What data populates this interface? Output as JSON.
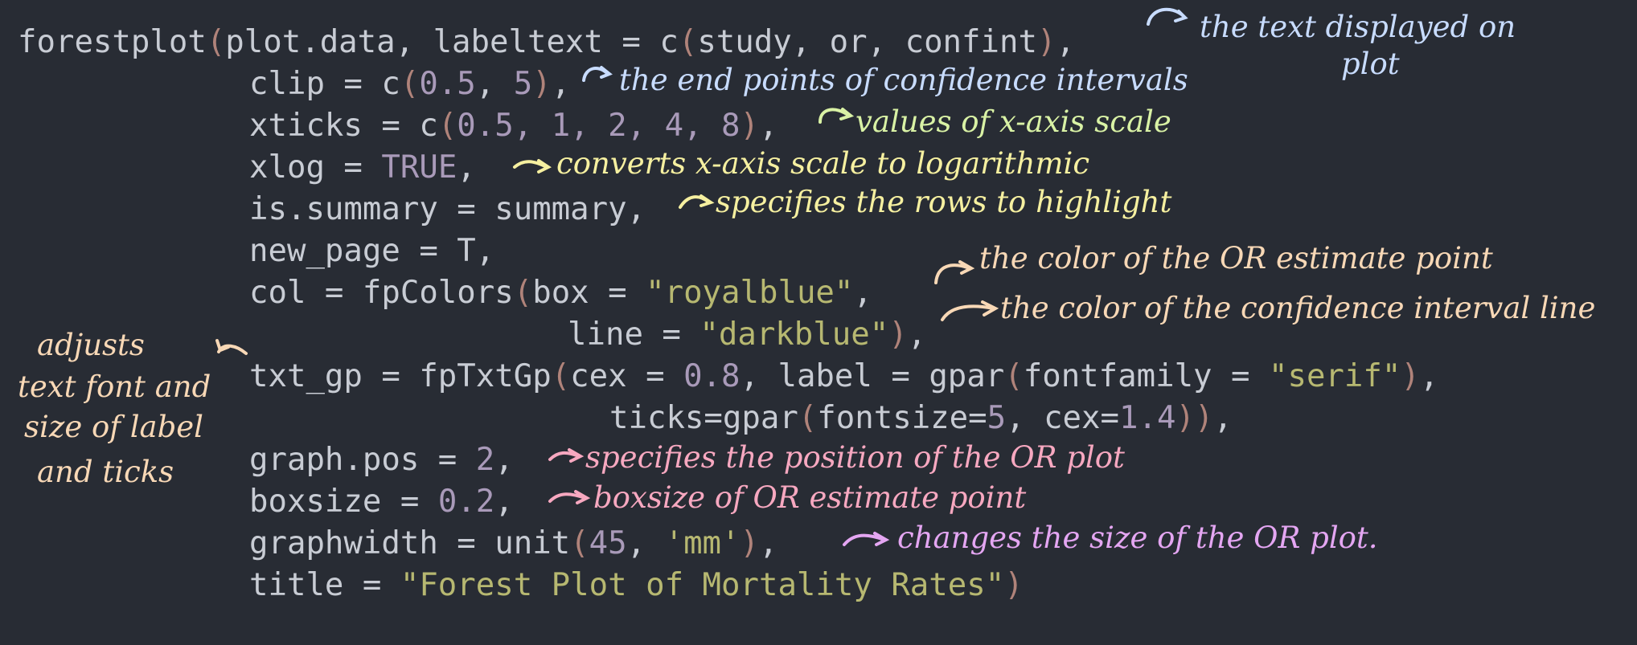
{
  "code": {
    "l1": {
      "fn": "forestplot",
      "p1": "(",
      "args": "plot.data, labeltext = c",
      "p2": "(",
      "inner": "study, or, confint",
      "p3": ")",
      "tail": ","
    },
    "l2": {
      "pre": "clip = c",
      "p1": "(",
      "n1": "0.5",
      "mid": ", ",
      "n2": "5",
      "p2": ")",
      "tail": ","
    },
    "l3": {
      "pre": "xticks = c",
      "p1": "(",
      "vals": "0.5, 1, 2, 4, 8",
      "p2": ")",
      "tail": ","
    },
    "l4": {
      "pre": "xlog = ",
      "kw": "TRUE",
      "tail": ","
    },
    "l5": {
      "text": "is.summary = summary,"
    },
    "l6": {
      "text": "new_page = T,"
    },
    "l7": {
      "pre": "col = fpColors",
      "p1": "(",
      "mid": "box = ",
      "str": "\"royalblue\"",
      "tail": ","
    },
    "l8": {
      "pre": "line = ",
      "str": "\"darkblue\"",
      "p1": ")",
      "tail": ","
    },
    "l9": {
      "pre": "txt_gp = fpTxtGp",
      "p1": "(",
      "a": "cex = ",
      "n1": "0.8",
      "b": ", label = gpar",
      "p2": "(",
      "c": "fontfamily = ",
      "str": "\"serif\"",
      "p3": ")",
      "tail": ","
    },
    "l10": {
      "pre": "ticks=gpar",
      "p1": "(",
      "a": "fontsize=",
      "n1": "5",
      "b": ", cex=",
      "n2": "1.4",
      "p2": "))",
      "tail": ","
    },
    "l11": {
      "pre": "graph.pos = ",
      "n1": "2",
      "tail": ","
    },
    "l12": {
      "pre": "boxsize = ",
      "n1": "0.2",
      "tail": ","
    },
    "l13": {
      "pre": "graphwidth = unit",
      "p1": "(",
      "n1": "45",
      "mid": ", ",
      "str": "'mm'",
      "p2": ")",
      "tail": ","
    },
    "l14": {
      "pre": "title = ",
      "str": "\"Forest Plot of Mortality Rates\"",
      "p1": ")"
    }
  },
  "annotations": {
    "labeltext_line1": "the text displayed on",
    "labeltext_line2": "plot",
    "clip": "the end points of confidence intervals",
    "xticks": "values of x-axis scale",
    "xlog": "converts x-axis scale to logarithmic",
    "summary": "specifies the rows to highlight",
    "box": "the color of the OR estimate point",
    "line": "the color of the confidence interval line",
    "txt_gp_1": "adjusts",
    "txt_gp_2": "text font and",
    "txt_gp_3": "size of label",
    "txt_gp_4": "and ticks",
    "graph_pos": "specifies the position of the OR plot",
    "boxsize": "boxsize of OR estimate point",
    "graphwidth": "changes the size of the OR plot."
  },
  "colors": {
    "background": "#282c34",
    "blue": "#c8dcff",
    "green": "#d9f2a5",
    "yellow": "#f6f0a0",
    "peach": "#f8d8b6",
    "pink": "#f7a8c0",
    "violet": "#e4a6f2"
  }
}
